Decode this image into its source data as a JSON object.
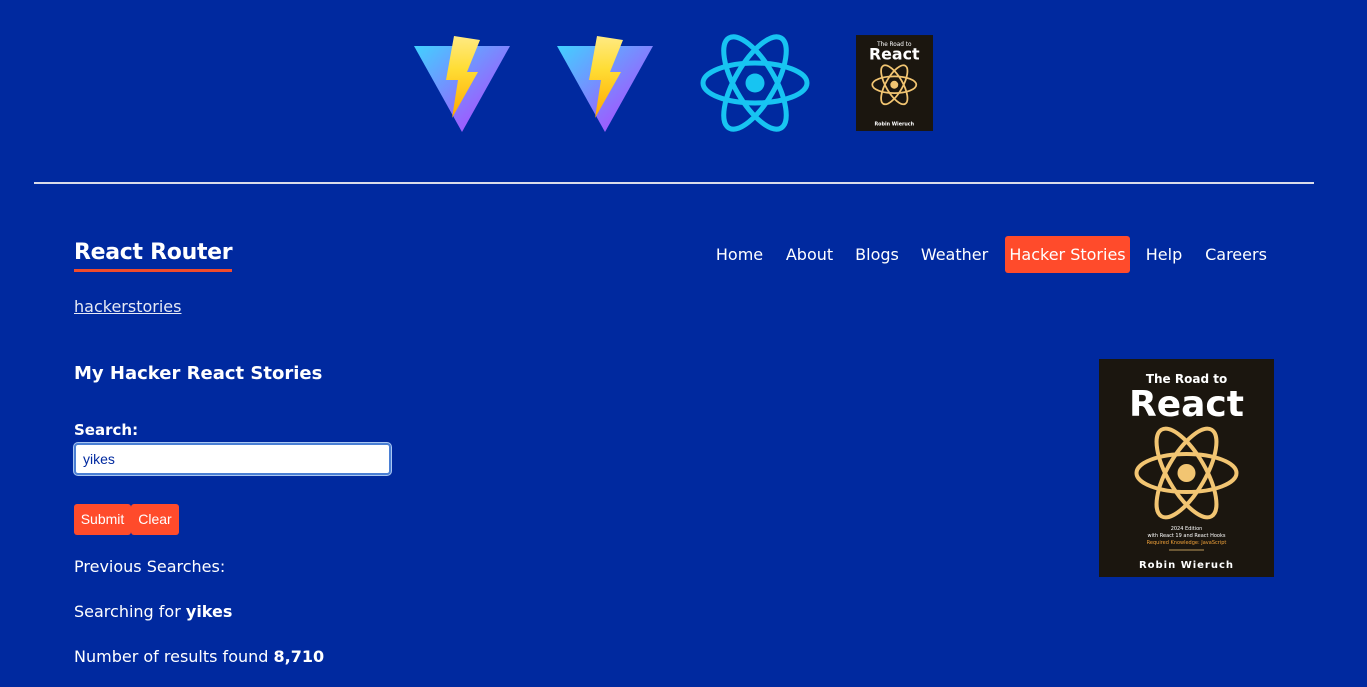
{
  "logos": [
    {
      "name": "vite-icon"
    },
    {
      "name": "vite-icon"
    },
    {
      "name": "react-icon"
    },
    {
      "name": "road-to-react-book-icon"
    }
  ],
  "brand": {
    "title": "React Router"
  },
  "nav": {
    "items": [
      {
        "label": "Home"
      },
      {
        "label": "About"
      },
      {
        "label": "Blogs"
      },
      {
        "label": "Weather"
      },
      {
        "label": "Hacker Stories",
        "active": true
      },
      {
        "label": "Help"
      },
      {
        "label": "Careers"
      }
    ]
  },
  "breadcrumb": {
    "link": "hackerstories"
  },
  "main": {
    "heading": "My Hacker React Stories",
    "search": {
      "label": "Search:",
      "value": "yikes"
    },
    "buttons": {
      "submit": "Submit",
      "clear": "Clear"
    },
    "previous_searches_label": "Previous Searches:",
    "searching_prefix": "Searching for",
    "searching_term": "yikes",
    "results_prefix": "Number of results found",
    "results_count": "8,710"
  },
  "book": {
    "title_small": "The Road to",
    "title_big": "React",
    "edition": "2024 Edition",
    "subtitle": "with React 19 and React Hooks",
    "required": "Required Knowledge: JavaScript",
    "author": "Robin Wieruch"
  },
  "colors": {
    "background": "#00299f",
    "accent": "#ff4b2b",
    "book_bg": "#1b160f",
    "book_react": "#f2c572"
  }
}
